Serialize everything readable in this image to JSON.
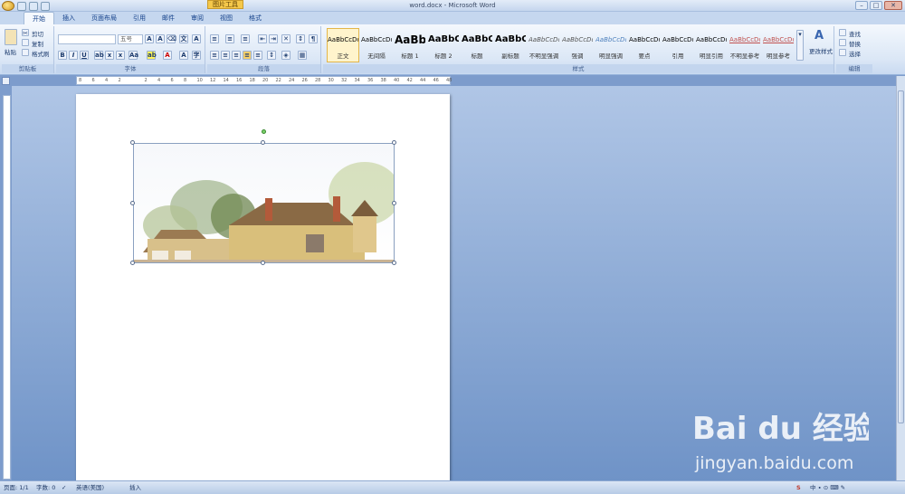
{
  "window": {
    "title": "word.docx - Microsoft Word",
    "context_tab": "图片工具"
  },
  "tabs": [
    "开始",
    "插入",
    "页面布局",
    "引用",
    "邮件",
    "审阅",
    "视图",
    "格式"
  ],
  "clipboard": {
    "paste": "粘贴",
    "cut": "剪切",
    "copy": "复制",
    "format_painter": "格式刷",
    "label": "剪贴板"
  },
  "font": {
    "name": "",
    "size": "五号",
    "label": "字体"
  },
  "paragraph": {
    "label": "段落"
  },
  "styles": {
    "label": "样式",
    "items": [
      {
        "preview": "AaBbCcDd",
        "name": "正文"
      },
      {
        "preview": "AaBbCcDd",
        "name": "无间隔"
      },
      {
        "preview": "AaBb",
        "name": "标题 1"
      },
      {
        "preview": "AaBbC",
        "name": "标题 2"
      },
      {
        "preview": "AaBbC",
        "name": "标题"
      },
      {
        "preview": "AaBbC",
        "name": "副标题"
      },
      {
        "preview": "AaBbCcDd",
        "name": "不明显强调"
      },
      {
        "preview": "AaBbCcDd",
        "name": "强调"
      },
      {
        "preview": "AaBbCcDd",
        "name": "明显强调"
      },
      {
        "preview": "AaBbCcDd",
        "name": "要点"
      },
      {
        "preview": "AaBbCcDd",
        "name": "引用"
      },
      {
        "preview": "AaBbCcDd",
        "name": "明显引用"
      },
      {
        "preview": "AaBbCcDd",
        "name": "不明显参考"
      },
      {
        "preview": "AaBbCcDd",
        "name": "明显参考"
      }
    ],
    "change": "更改样式"
  },
  "editing": {
    "find": "查找",
    "replace": "替换",
    "select": "选择",
    "label": "编辑"
  },
  "ruler": {
    "numbers": [
      "8",
      "6",
      "4",
      "2",
      "",
      "2",
      "4",
      "6",
      "8",
      "10",
      "12",
      "14",
      "16",
      "18",
      "20",
      "22",
      "24",
      "26",
      "28",
      "30",
      "32",
      "34",
      "36",
      "38",
      "40",
      "42",
      "44",
      "46",
      "48"
    ]
  },
  "status": {
    "page": "页面: 1/1",
    "words": "字数: 0",
    "language": "英语(美国)",
    "mode": "插入"
  },
  "watermark": {
    "brand": "Bai du 经验",
    "url": "jingyan.baidu.com"
  },
  "colors": {
    "ribbon": "#dbe7f6",
    "workspace": "#7d9ccc",
    "accent": "#15428b"
  }
}
